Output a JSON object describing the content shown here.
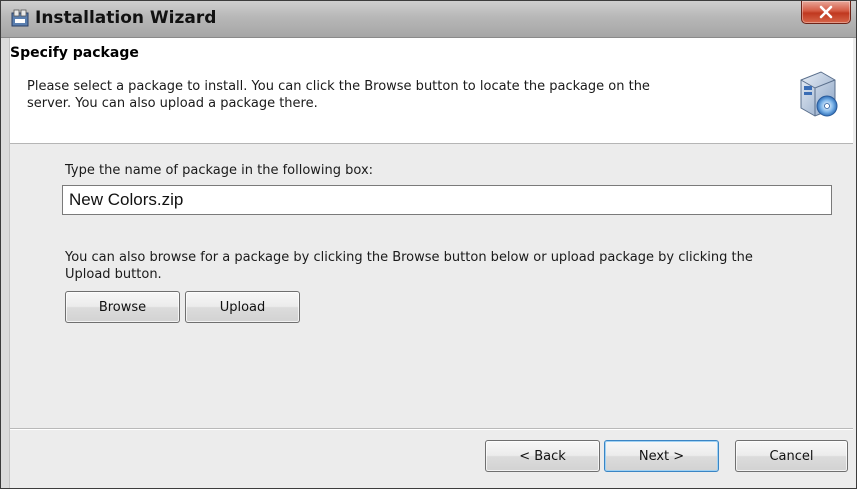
{
  "window": {
    "title": "Installation Wizard",
    "icon": "installer-app-icon"
  },
  "header": {
    "title": "Specify package",
    "description_lines": [
      "Please select a package to install. You can click the Browse button to locate the package on the",
      "server. You can also upload a package there."
    ],
    "icon": "package-install-icon"
  },
  "main": {
    "input_label": "Type the name of package in the following box:",
    "package_name_value": "New Colors.zip",
    "hint_lines": [
      "You can also browse for a package by clicking the Browse button below or upload package by clicking the",
      "Upload button."
    ],
    "browse_label": "Browse",
    "upload_label": "Upload"
  },
  "footer": {
    "back_label": "< Back",
    "next_label": "Next >",
    "cancel_label": "Cancel"
  },
  "colors": {
    "close_button": "#c7442b",
    "default_button_border": "#3a85c4",
    "titlebar": "#b7b7b7"
  }
}
